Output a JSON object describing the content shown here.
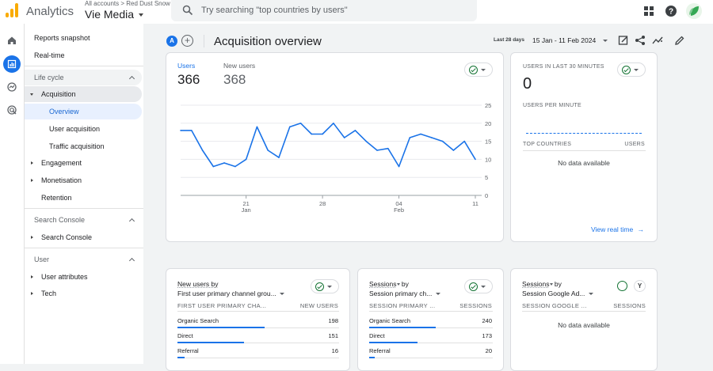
{
  "app": {
    "name": "Analytics",
    "breadcrumb": "All accounts > Red Dust Snow",
    "account": "Vie Media"
  },
  "search": {
    "placeholder": "Try searching \"top countries by users\""
  },
  "colors": {
    "accent": "#1a73e8",
    "ok": "#137333",
    "logo": "#f9ab00"
  },
  "nav": {
    "reports_snapshot": "Reports snapshot",
    "realtime": "Real-time",
    "lifecycle": "Life cycle",
    "acquisition": "Acquisition",
    "overview": "Overview",
    "user_acquisition": "User acquisition",
    "traffic_acquisition": "Traffic acquisition",
    "engagement": "Engagement",
    "monetisation": "Monetisation",
    "retention": "Retention",
    "search_console_sec": "Search Console",
    "search_console": "Search Console",
    "user_sec": "User",
    "user_attributes": "User attributes",
    "tech": "Tech"
  },
  "header": {
    "badge": "A",
    "title": "Acquisition overview",
    "date_badge": "Last 28 days",
    "date_range": "15 Jan - 11 Feb 2024"
  },
  "users_card": {
    "users_label": "Users",
    "users_value": "366",
    "new_users_label": "New users",
    "new_users_value": "368"
  },
  "chart_data": {
    "type": "line",
    "series": [
      {
        "values": [
          18,
          18,
          12.5,
          8,
          9,
          8,
          10,
          19,
          12.5,
          10.5,
          19,
          20,
          17,
          17,
          20,
          16,
          18,
          15,
          12.5,
          13,
          8,
          16,
          17,
          16,
          15,
          12.5,
          15,
          10
        ]
      }
    ],
    "y_ticks": [
      "25",
      "20",
      "15",
      "10",
      "5",
      "0"
    ],
    "ylim": [
      0,
      25
    ],
    "x_ticks": [
      {
        "label": "21",
        "sub": "Jan",
        "index": 6
      },
      {
        "label": "28",
        "sub": "",
        "index": 13
      },
      {
        "label": "04",
        "sub": "Feb",
        "index": 20
      },
      {
        "label": "11",
        "sub": "",
        "index": 27
      }
    ],
    "grid": true
  },
  "realtime_card": {
    "title": "USERS IN LAST 30 MINUTES",
    "value": "0",
    "per_minute": "USERS PER MINUTE",
    "col1": "TOP COUNTRIES",
    "col2": "USERS",
    "empty": "No data available",
    "link": "View real time"
  },
  "new_users_card": {
    "title": "New users by",
    "dimension": "First user primary channel grou...",
    "col1": "FIRST USER PRIMARY CHA...",
    "col2": "NEW USERS",
    "rows": [
      {
        "label": "Organic Search",
        "value": "198",
        "fraction": 1.0
      },
      {
        "label": "Direct",
        "value": "151",
        "fraction": 0.76
      },
      {
        "label": "Referral",
        "value": "16",
        "fraction": 0.08
      }
    ]
  },
  "sessions_card": {
    "title": "Sessions",
    "by": "by",
    "dimension": "Session primary ch...",
    "col1": "SESSION PRIMARY ...",
    "col2": "SESSIONS",
    "rows": [
      {
        "label": "Organic Search",
        "value": "240",
        "fraction": 1.0
      },
      {
        "label": "Direct",
        "value": "173",
        "fraction": 0.72
      },
      {
        "label": "Referral",
        "value": "20",
        "fraction": 0.08
      }
    ]
  },
  "sessions_ads_card": {
    "title": "Sessions",
    "by": "by",
    "dimension": "Session Google Ad...",
    "col1": "SESSION GOOGLE ...",
    "col2": "SESSIONS",
    "empty": "No data available"
  }
}
